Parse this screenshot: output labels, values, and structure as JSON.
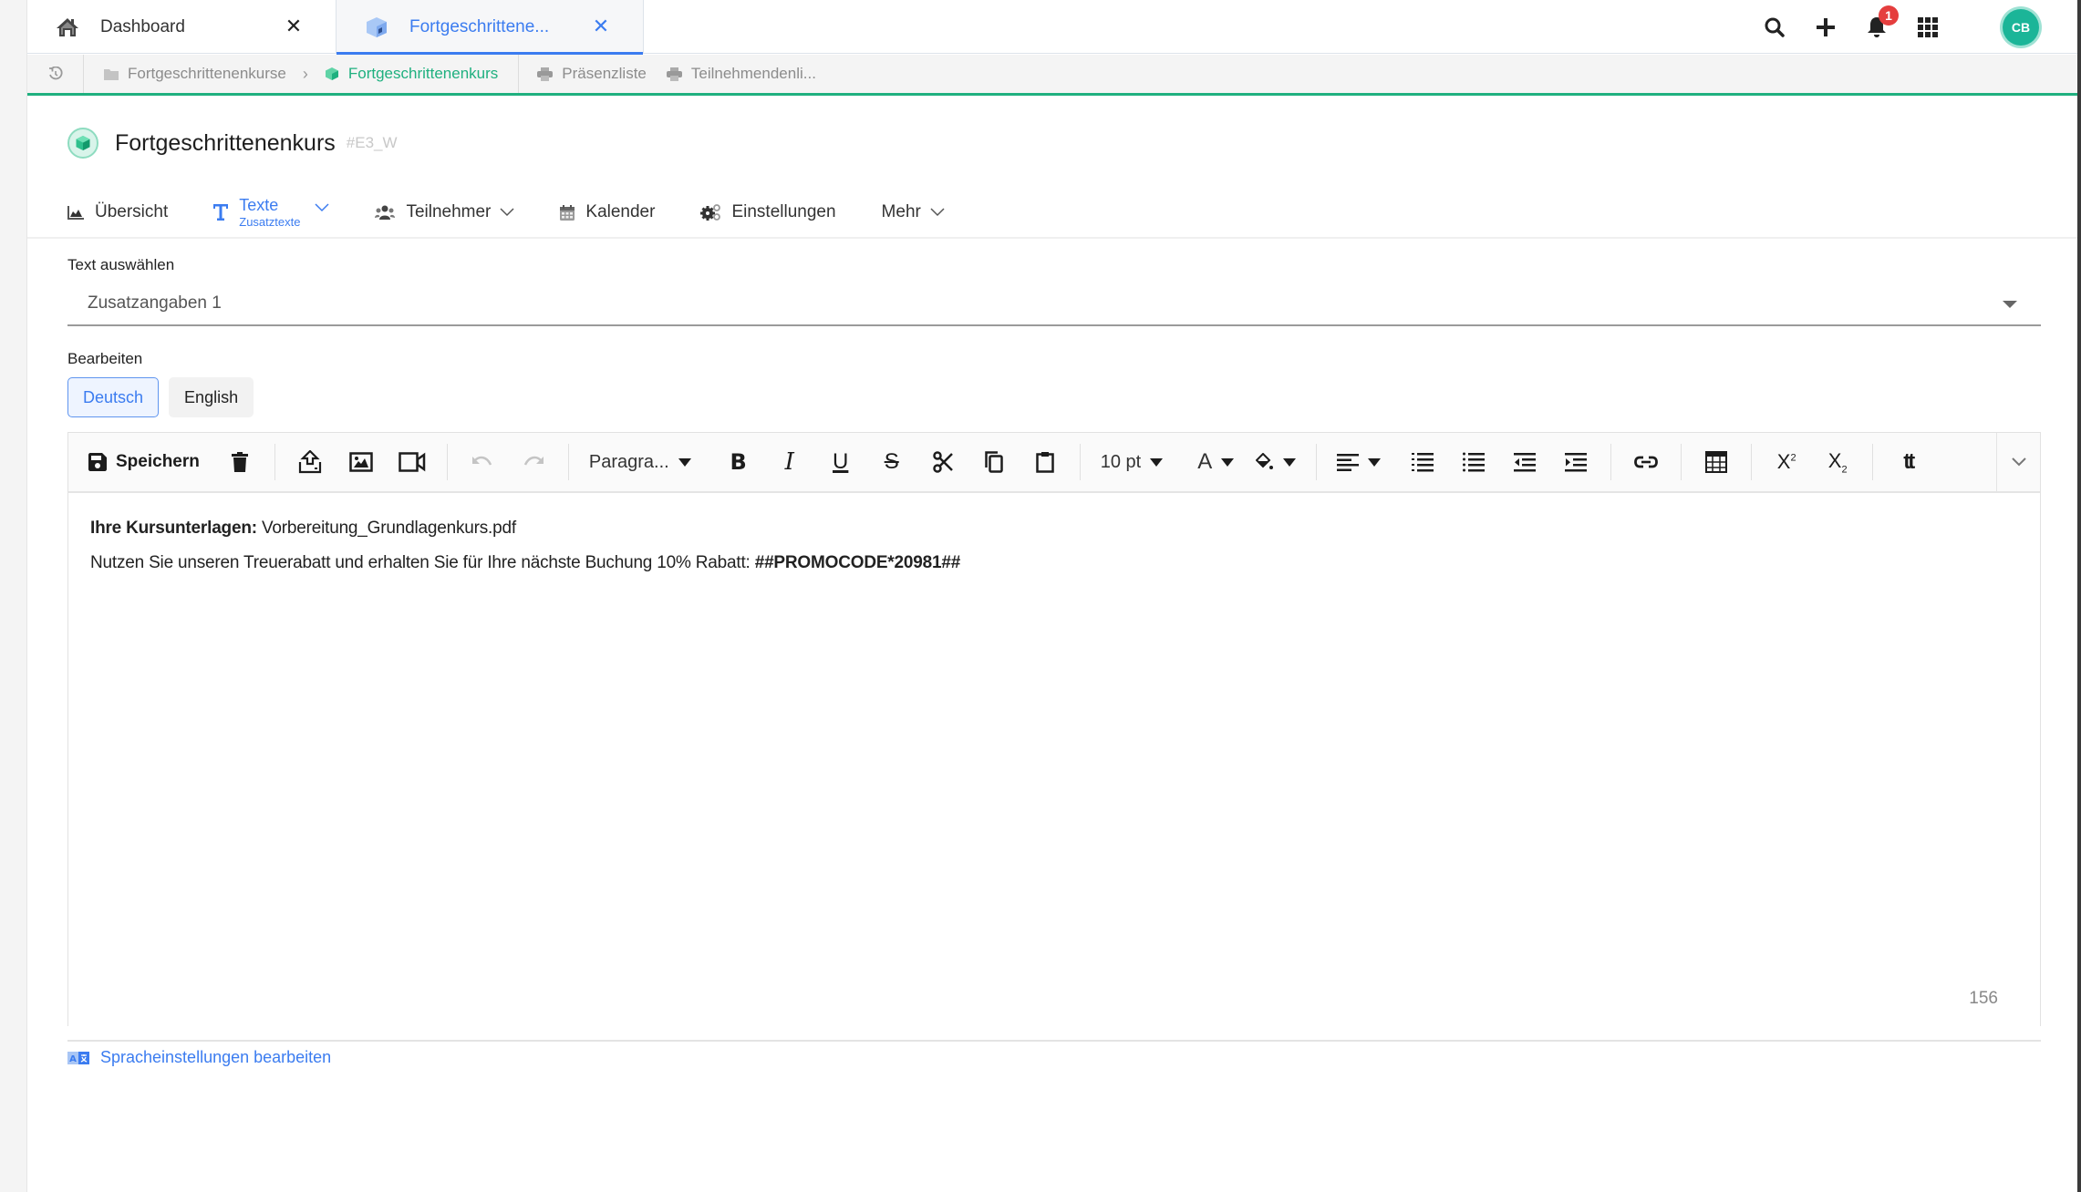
{
  "tabs": [
    {
      "label": "Dashboard",
      "icon": "home-icon",
      "active": false
    },
    {
      "label": "Fortgeschrittene...",
      "icon": "cube-icon",
      "active": true
    }
  ],
  "top_actions": {
    "notifications_count": "1",
    "avatar_initials": "CB"
  },
  "breadcrumb": {
    "items": [
      {
        "label": "Fortgeschrittenenkurse",
        "icon": "folder-icon"
      },
      {
        "label": "Fortgeschrittenenkurs",
        "icon": "cube-icon",
        "active": true
      }
    ],
    "shortcuts": [
      {
        "label": "Präsenzliste",
        "icon": "printer-icon"
      },
      {
        "label": "Teilnehmendenli...",
        "icon": "printer-icon"
      }
    ]
  },
  "page": {
    "title": "Fortgeschrittenenkurs",
    "id": "#E3_W"
  },
  "nav": {
    "items": [
      {
        "label": "Übersicht",
        "icon": "chart-area-icon"
      },
      {
        "label": "Texte",
        "sublabel": "Zusatztexte",
        "icon": "text-icon",
        "active": true,
        "has_dropdown": true
      },
      {
        "label": "Teilnehmer",
        "icon": "users-icon",
        "has_dropdown": true
      },
      {
        "label": "Kalender",
        "icon": "calendar-icon"
      },
      {
        "label": "Einstellungen",
        "icon": "gears-icon"
      },
      {
        "label": "Mehr",
        "has_dropdown": true
      }
    ]
  },
  "form": {
    "select_label": "Text auswählen",
    "select_value": "Zusatzangaben 1",
    "edit_label": "Bearbeiten",
    "languages": [
      {
        "label": "Deutsch",
        "active": true
      },
      {
        "label": "English",
        "active": false
      }
    ]
  },
  "editor": {
    "toolbar": {
      "save_label": "Speichern",
      "paragraph_label": "Paragra...",
      "font_size_label": "10 pt"
    },
    "content": {
      "line1_bold": "Ihre Kursunterlagen:",
      "line1_rest": " Vorbereitung_Grundlagenkurs.pdf",
      "line2_text": "Nutzen Sie unseren Treuerabatt und erhalten Sie für Ihre nächste Buchung 10% Rabatt: ",
      "line2_bold": "##PROMOCODE*20981##"
    },
    "char_count": "156"
  },
  "footer": {
    "language_settings_link": "Spracheinstellungen bearbeiten"
  },
  "colors": {
    "accent_blue": "#3b7cf0",
    "accent_green": "#1fb07f",
    "avatar_bg": "#1bb598",
    "badge_red": "#e53e3e"
  }
}
